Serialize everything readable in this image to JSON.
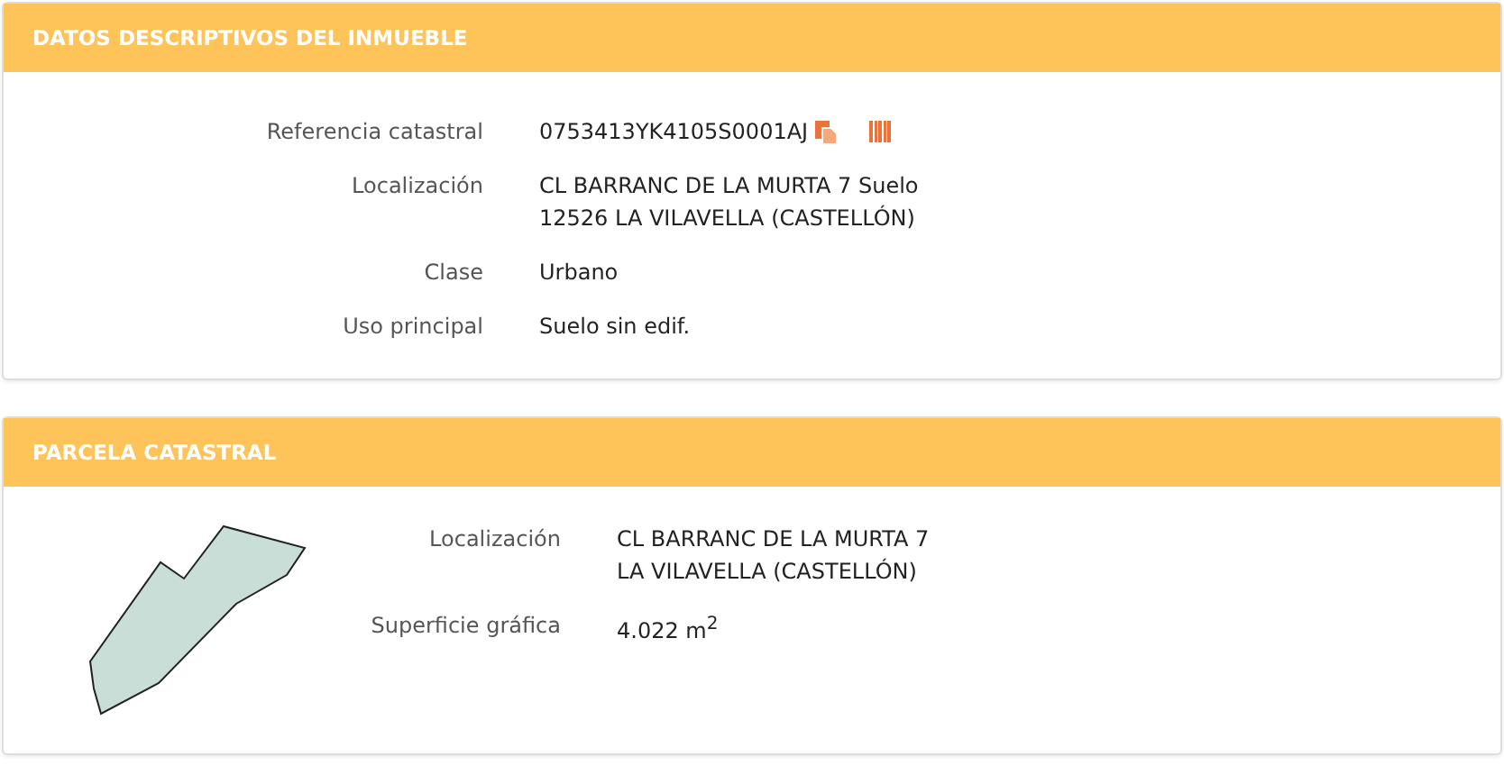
{
  "panels": [
    {
      "title": "DATOS DESCRIPTIVOS DEL INMUEBLE",
      "kind": "details",
      "rows": [
        {
          "label": "Referencia catastral",
          "lines": [
            "0753413YK4105S0001AJ"
          ],
          "icons": true
        },
        {
          "label": "Localización",
          "lines": [
            "CL BARRANC DE LA MURTA 7 Suelo",
            "12526 LA VILAVELLA (CASTELLÓN)"
          ]
        },
        {
          "label": "Clase",
          "lines": [
            "Urbano"
          ]
        },
        {
          "label": "Uso principal",
          "lines": [
            "Suelo sin edif."
          ]
        }
      ]
    },
    {
      "title": "PARCELA CATASTRAL",
      "kind": "parcel",
      "rows": [
        {
          "label": "Localización",
          "lines": [
            "CL BARRANC DE LA MURTA 7",
            "LA VILAVELLA (CASTELLÓN)"
          ]
        },
        {
          "label": "Superficie gráfica",
          "lines": [
            "4.022 m$^{2}$"
          ]
        }
      ]
    }
  ]
}
